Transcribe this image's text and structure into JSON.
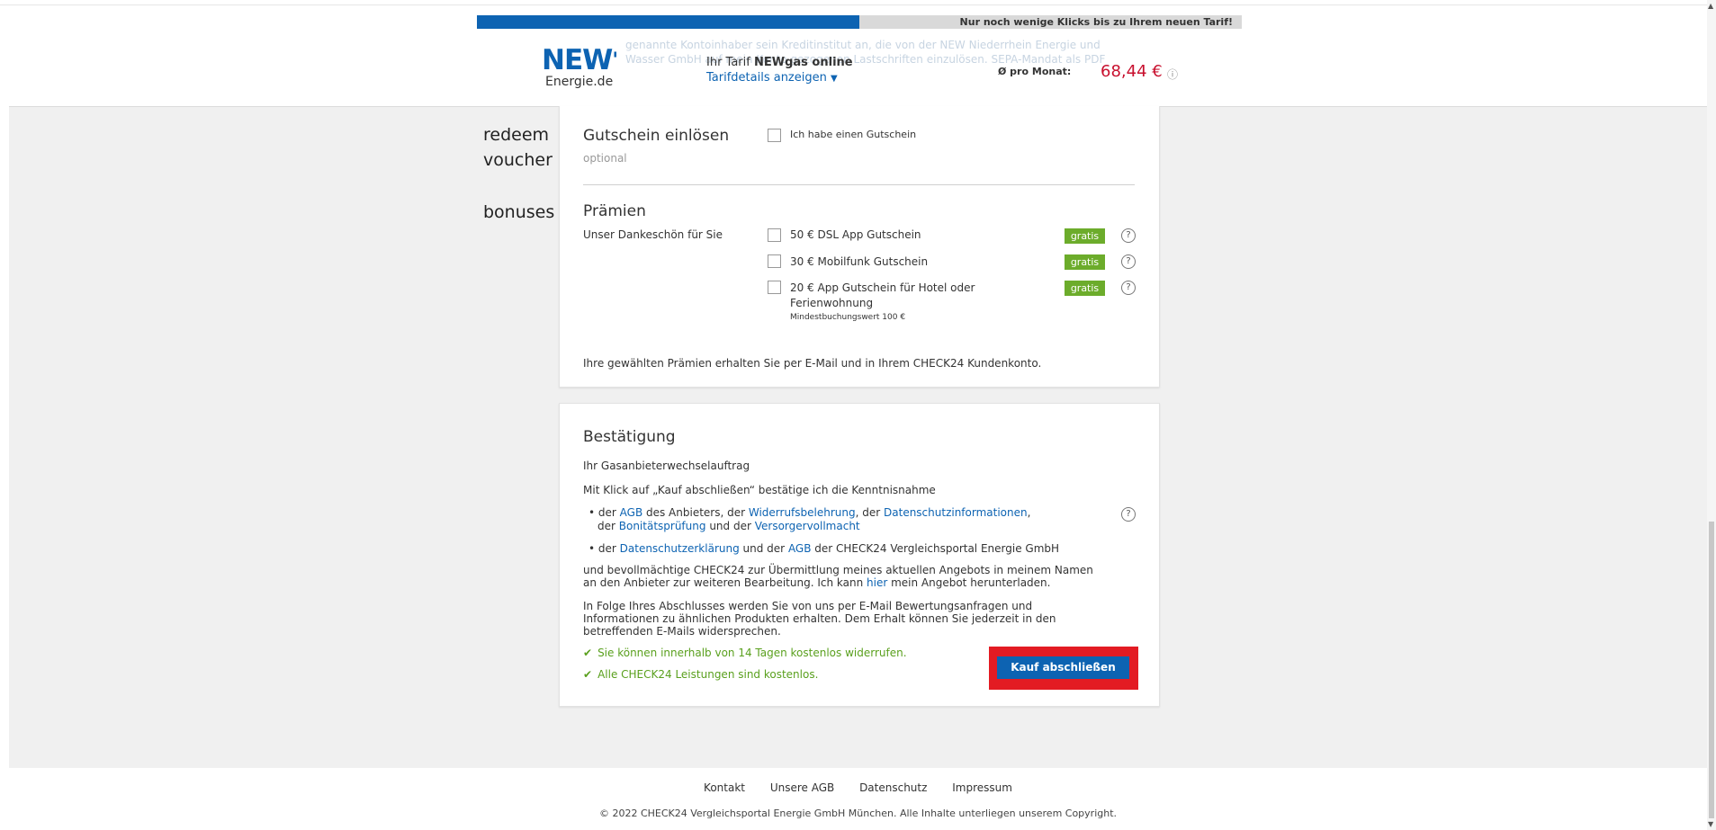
{
  "progress": {
    "text": "Nur noch wenige Klicks bis zu Ihrem neuen Tarif!",
    "fraction": 0.5
  },
  "header": {
    "ghost_text": "genannte Kontoinhaber sein Kreditinstitut an, die von der NEW Niederrhein Energie und Wasser GmbH auf mein Konto gezogenen Lastschriften einzulösen. SEPA-Mandat als PDF",
    "logo_word_1": "NE",
    "logo_word_2": "W",
    "logo_apos": "'",
    "logo_sub": "Energie.de",
    "tariff_prefix": "Ihr Tarif ",
    "tariff_name": "NEWgas online",
    "tariff_details": "Tarifdetails anzeigen",
    "month_label": "Ø pro Monat:",
    "month_price": "68,44 €"
  },
  "notes": {
    "voucher_1": "redeem",
    "voucher_2": "voucher",
    "bonuses": "bonuses"
  },
  "voucher": {
    "title": "Gutschein einlösen",
    "optional": "optional",
    "checkbox_label": "Ich habe einen Gutschein"
  },
  "bonuses": {
    "title": "Prämien",
    "subtitle": "Unser Dankeschön für Sie",
    "items": [
      {
        "label": "50 € DSL App Gutschein",
        "badge": "gratis"
      },
      {
        "label": "30 € Mobilfunk Gutschein",
        "badge": "gratis"
      },
      {
        "label": "20 € App Gutschein für Hotel oder",
        "label2": "Ferienwohnung",
        "note": "Mindestbuchungswert 100 €",
        "badge": "gratis"
      }
    ],
    "footer": "Ihre gewählten Prämien erhalten Sie per E-Mail und in Ihrem CHECK24 Kundenkonto."
  },
  "confirm": {
    "title": "Bestätigung",
    "order": "Ihr Gasanbieterwechselauftrag",
    "intro": "Mit Klick auf „Kauf abschließen“ bestätige ich die Kenntnisnahme",
    "b1": {
      "t1": "• der ",
      "l1": "AGB",
      "t2": " des Anbieters, der ",
      "l2": "Widerrufsbelehrung",
      "t3": ", der ",
      "l3": "Datenschutzinformationen",
      "t4": ",",
      "t5": "der ",
      "l4": "Bonitätsprüfung",
      "t6": " und der ",
      "l5": "Versorgervollmacht"
    },
    "b2": {
      "t1": "• der ",
      "l1": "Datenschutzerklärung",
      "t2": " und der ",
      "l2": "AGB",
      "t3": " der CHECK24 Vergleichsportal Energie GmbH"
    },
    "para1_line1": "und bevollmächtige CHECK24 zur Übermittlung meines aktuellen Angebots in meinem Namen",
    "para1_line2_a": "an den Anbieter zur weiteren Bearbeitung. Ich kann ",
    "para1_link": "hier",
    "para1_line2_b": " mein Angebot herunterladen.",
    "para2_line1": "In Folge Ihres Abschlusses werden Sie von uns per E-Mail Bewertungsanfragen und",
    "para2_line2": "Informationen zu ähnlichen Produkten erhalten. Dem Erhalt können Sie jederzeit in den",
    "para2_line3": "betreffenden E-Mails widersprechen.",
    "check1": "Sie können innerhalb von 14 Tagen kostenlos widerrufen.",
    "check2": "Alle CHECK24 Leistungen sind kostenlos.",
    "cta": "Kauf abschließen"
  },
  "footer": {
    "links": [
      "Kontakt",
      "Unsere AGB",
      "Datenschutz",
      "Impressum"
    ],
    "copyright": "© 2022 CHECK24 Vergleichsportal Energie GmbH München. Alle Inhalte unterliegen unserem Copyright."
  },
  "colors": {
    "brand_blue": "#0d63b2",
    "price_red": "#c8102e",
    "green": "#6cac2b",
    "highlight_red": "#e31b23"
  }
}
